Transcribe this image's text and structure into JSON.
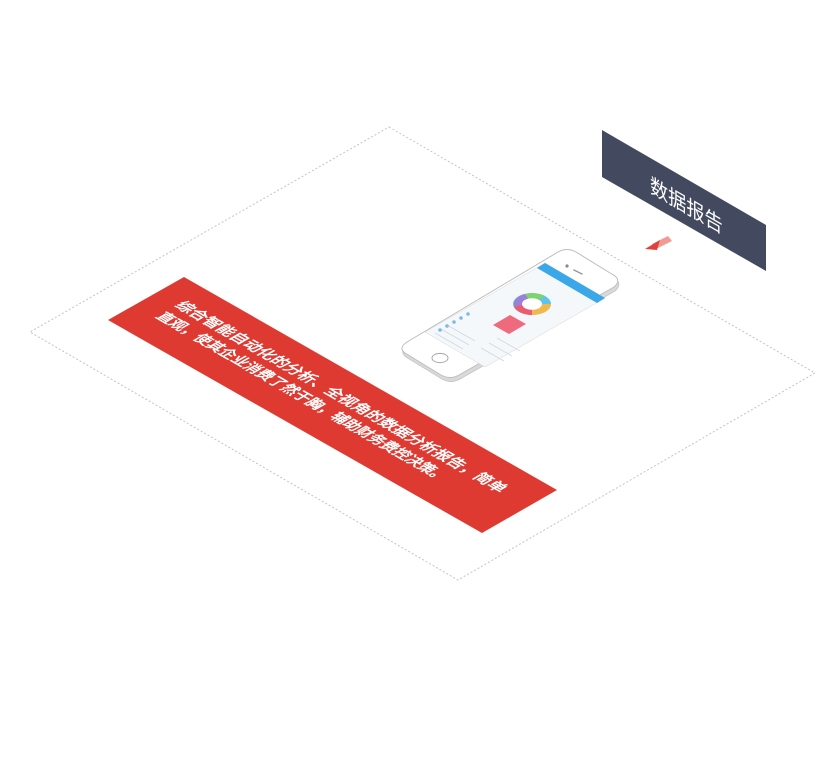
{
  "tag": {
    "title": "数据报告",
    "bg_color": "#434a60"
  },
  "banner": {
    "line1": "综合智能自动化的分析、全视角的数据分析报告，简单",
    "line2": "直观，使其企业消费了然于胸，辅助财务费控决策。",
    "bg_color": "#de3a32"
  },
  "accent": {
    "arrow_color": "#e0413a",
    "outline_color": "#bfbfbf",
    "phone_header_color": "#3aa7e8"
  }
}
